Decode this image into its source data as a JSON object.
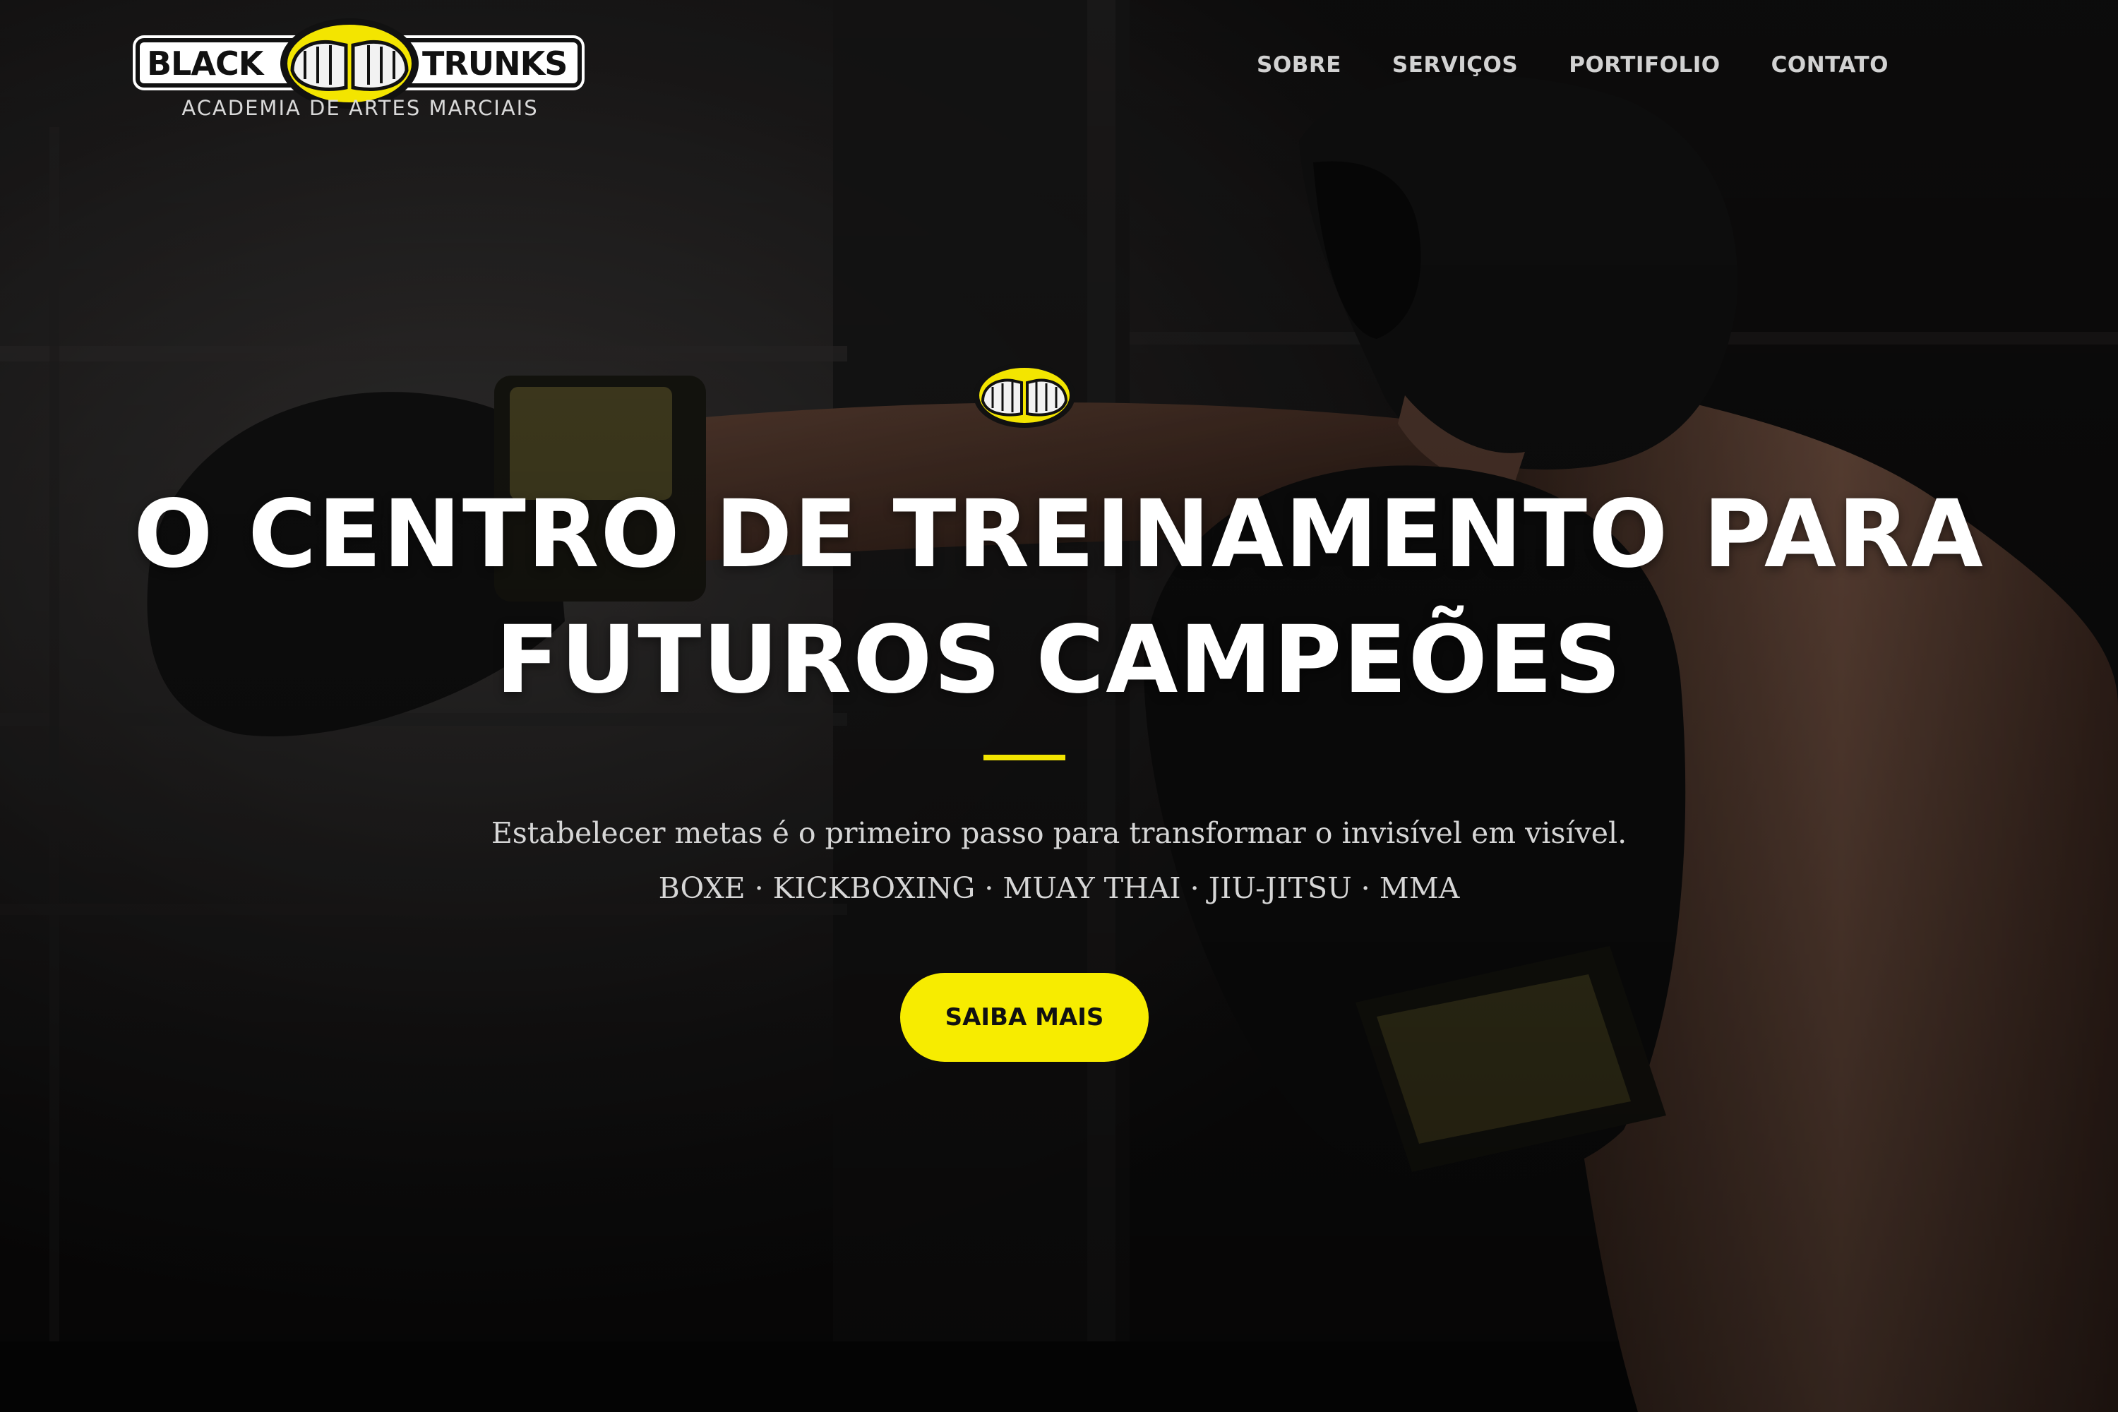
{
  "brand": {
    "word_left": "BLACK",
    "word_right": "TRUNKS",
    "tagline": "ACADEMIA DE ARTES MARCIAIS",
    "emblem_icon": "fist-emblem-icon",
    "accent_color": "#f7ec00"
  },
  "nav": {
    "items": [
      {
        "label": "SOBRE"
      },
      {
        "label": "SERVIÇOS"
      },
      {
        "label": "PORTIFOLIO"
      },
      {
        "label": "CONTATO"
      }
    ]
  },
  "hero": {
    "emblem_icon": "fist-emblem-icon",
    "title_line1": "O CENTRO DE TREINAMENTO PARA",
    "title_line2": "FUTUROS CAMPEÕES",
    "subtitle_line1": "Estabelecer metas é o primeiro passo para transformar o invisível em visível.",
    "subtitle_line2": "BOXE · KICKBOXING · MUAY THAI · JIU-JITSU · MMA",
    "cta_label": "SAIBA MAIS",
    "background": "boxer-photo"
  }
}
